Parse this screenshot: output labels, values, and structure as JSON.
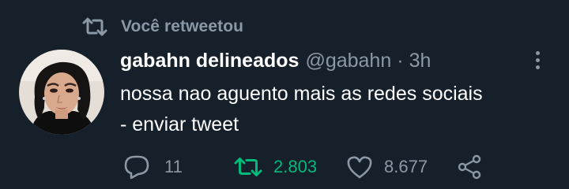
{
  "retweet_banner": {
    "text": "Você retweetou",
    "icon": "retweet-icon"
  },
  "tweet": {
    "author_name": "gabahn delineados",
    "handle": "@gabahn",
    "separator": "·",
    "time": "3h",
    "text_lines": [
      "nossa nao aguento mais as redes sociais",
      "- enviar tweet"
    ]
  },
  "actions": {
    "reply_count": "11",
    "retweet_count": "2.803",
    "like_count": "8.677"
  },
  "colors": {
    "background": "#15202b",
    "muted": "#8b98a5",
    "text": "#ffffff",
    "retweet_active": "#00ba7c"
  }
}
